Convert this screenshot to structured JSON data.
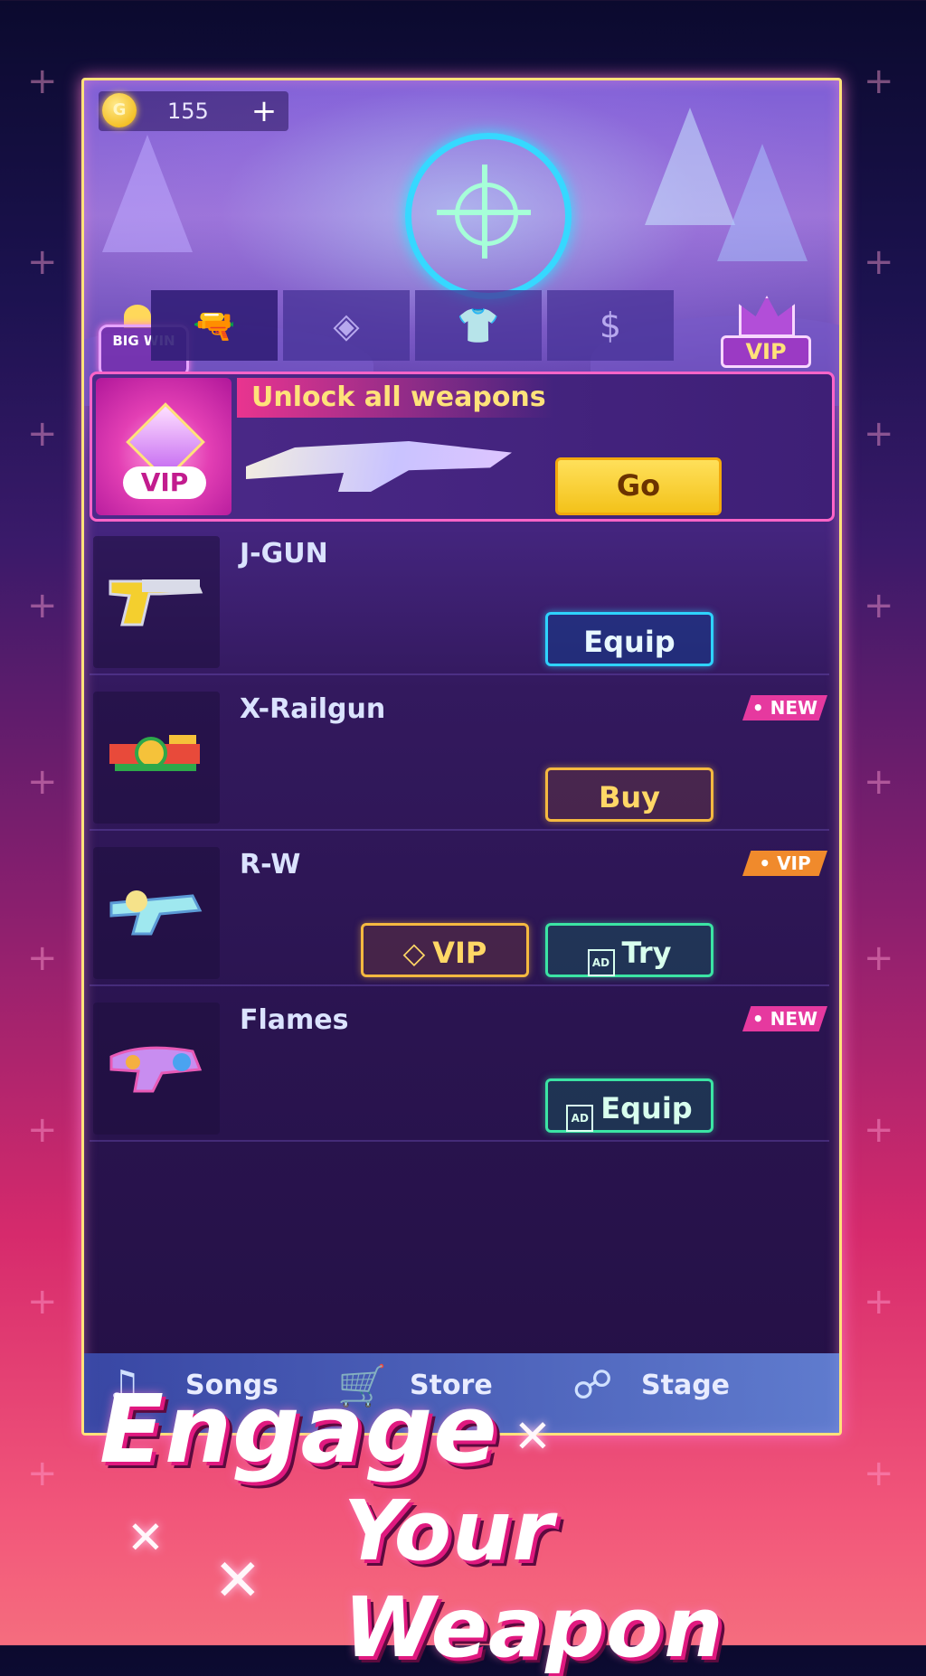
{
  "currency": {
    "symbol": "G",
    "amount": "155",
    "add_label": "+"
  },
  "tabs": [
    {
      "icon": "pistol-icon",
      "glyph": "🔫"
    },
    {
      "icon": "diamond-tile-icon",
      "glyph": "◈"
    },
    {
      "icon": "shirt-icon",
      "glyph": "👕"
    },
    {
      "icon": "dollar-icon",
      "glyph": "$"
    }
  ],
  "big_win": {
    "label": "BIG WIN"
  },
  "vip_badge": {
    "label": "VIP"
  },
  "banner": {
    "title": "Unlock all weapons",
    "vip_label": "VIP",
    "button": "Go"
  },
  "weapons": [
    {
      "name": "J-GUN",
      "tag": "",
      "buttons": [
        {
          "label": "Equip",
          "style": "blue",
          "ad": false
        }
      ]
    },
    {
      "name": "X-Railgun",
      "tag": "• NEW",
      "buttons": [
        {
          "label": "Buy",
          "style": "gold",
          "ad": false
        }
      ]
    },
    {
      "name": "R-W",
      "tag": "• VIP",
      "buttons": [
        {
          "label": "VIP",
          "style": "gold",
          "ad": false
        },
        {
          "label": "Try",
          "style": "green",
          "ad": true
        }
      ]
    },
    {
      "name": "Flames",
      "tag": "• NEW",
      "buttons": [
        {
          "label": "Equip",
          "style": "green",
          "ad": true
        }
      ]
    }
  ],
  "ad_icon_text": "AD",
  "vip_button_icon": "◇",
  "nav": {
    "songs": "Songs",
    "store": "Store",
    "stage": "Stage"
  },
  "tagline": {
    "line1": "Engage",
    "line2": "Your Weapon"
  },
  "colors": {
    "accent_gold": "#ffe27a",
    "neon_blue": "#2ed3ff",
    "neon_green": "#3be4a4",
    "pink": "#e6399f"
  }
}
